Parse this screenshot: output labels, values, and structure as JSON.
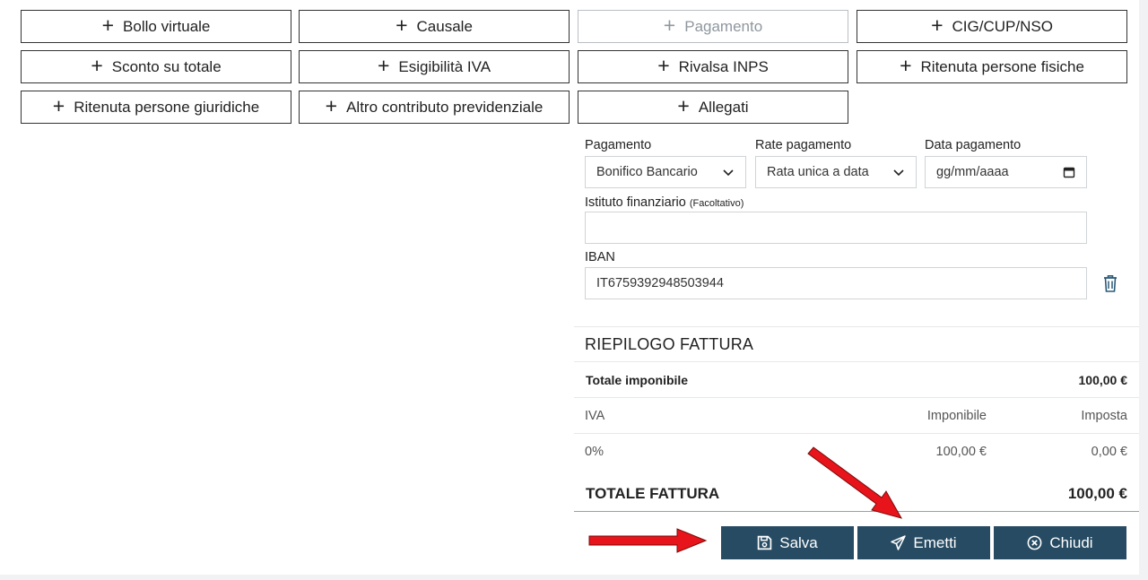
{
  "add_buttons": [
    {
      "label": "Bollo virtuale"
    },
    {
      "label": "Causale"
    },
    {
      "label": "Pagamento"
    },
    {
      "label": "CIG/CUP/NSO"
    },
    {
      "label": "Sconto su totale"
    },
    {
      "label": "Esigibilità IVA"
    },
    {
      "label": "Rivalsa INPS"
    },
    {
      "label": "Ritenuta persone fisiche"
    },
    {
      "label": "Ritenuta persone giuridiche"
    },
    {
      "label": "Altro contributo previdenziale"
    },
    {
      "label": "Allegati"
    }
  ],
  "payment": {
    "method_label": "Pagamento",
    "method_value": "Bonifico Bancario",
    "installments_label": "Rate pagamento",
    "installments_value": "Rata unica a data",
    "date_label": "Data pagamento",
    "date_value": "gg/mm/aaaa",
    "institute_label": "Istituto finanziario",
    "institute_optional": "(Facoltativo)",
    "institute_value": "",
    "iban_label": "IBAN",
    "iban_value": "IT6759392948503944"
  },
  "summary": {
    "title": "RIEPILOGO FATTURA",
    "taxable_label": "Totale imponibile",
    "taxable_value": "100,00 €",
    "col_iva": "IVA",
    "col_imponibile": "Imponibile",
    "col_imposta": "Imposta",
    "row_iva": "0%",
    "row_imponibile": "100,00 €",
    "row_imposta": "0,00 €",
    "total_label": "TOTALE FATTURA",
    "total_value": "100,00 €"
  },
  "actions": {
    "save_label": "Salva",
    "emit_label": "Emetti",
    "close_label": "Chiudi"
  },
  "colors": {
    "action_bg": "#264b63",
    "annotation_arrow": "#e8141b"
  }
}
